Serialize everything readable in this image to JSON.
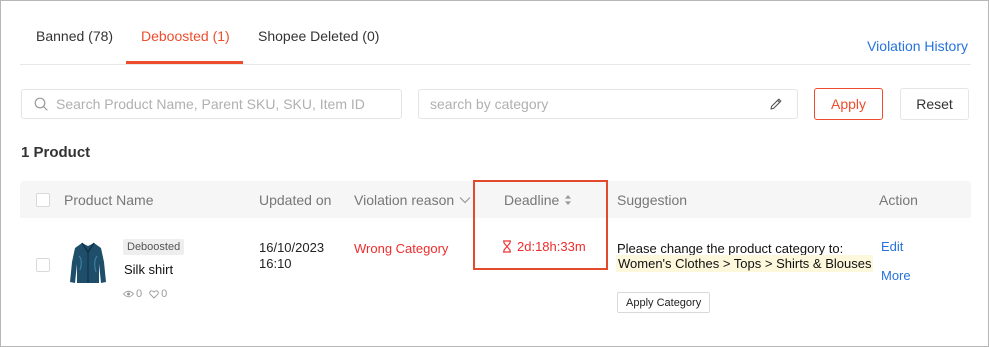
{
  "tabs": [
    {
      "label": "Banned (78)",
      "active": false
    },
    {
      "label": "Deboosted (1)",
      "active": true
    },
    {
      "label": "Shopee Deleted (0)",
      "active": false
    }
  ],
  "violation_history_link": "Violation History",
  "filters": {
    "search_placeholder": "Search Product Name, Parent SKU, SKU, Item ID",
    "category_placeholder": "search by category",
    "apply_label": "Apply",
    "reset_label": "Reset"
  },
  "product_count": "1 Product",
  "table": {
    "headers": {
      "name": "Product Name",
      "updated": "Updated on",
      "reason": "Violation reason",
      "deadline": "Deadline",
      "suggestion": "Suggestion",
      "action": "Action"
    },
    "rows": [
      {
        "badge": "Deboosted",
        "name": "Silk shirt",
        "views": "0",
        "likes": "0",
        "updated_date": "16/10/2023",
        "updated_time": "16:10",
        "reason": "Wrong Category",
        "deadline": "2d:18h:33m",
        "suggestion_text": "Please change the product category to:",
        "suggestion_category": "Women's Clothes > Tops > Shirts & Blouses",
        "apply_category_label": "Apply Category",
        "actions": {
          "edit": "Edit",
          "more": "More"
        }
      }
    ]
  },
  "colors": {
    "accent": "#ee4d2d",
    "link": "#2673dd",
    "deadline_red": "#ee2c2c",
    "highlight_border": "#e34a2b",
    "category_highlight": "#fdf8dc"
  },
  "icons": [
    "search-icon",
    "pencil-icon",
    "chevron-down-icon",
    "sort-icon",
    "hourglass-icon",
    "eye-icon",
    "heart-icon"
  ]
}
